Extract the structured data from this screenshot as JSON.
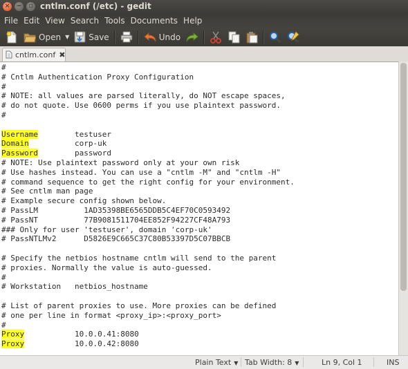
{
  "window": {
    "title": "cntlm.conf (/etc) - gedit",
    "close_glyph": "×",
    "min_glyph": "−",
    "max_glyph": "▫"
  },
  "menu": [
    "File",
    "Edit",
    "View",
    "Search",
    "Tools",
    "Documents",
    "Help"
  ],
  "toolbar": {
    "open_label": "Open",
    "save_label": "Save",
    "undo_label": "Undo",
    "icons": [
      "new-document-icon",
      "open-folder-icon",
      "open-dropdown-icon",
      "save-icon",
      "print-icon",
      "undo-icon",
      "redo-icon",
      "cut-icon",
      "copy-icon",
      "paste-icon",
      "find-icon",
      "find-replace-icon"
    ],
    "colors": {
      "undo_arrow": "#e07a3e",
      "redo_arrow": "#7bb33a",
      "highlight": "#ffff22"
    }
  },
  "tab": {
    "label": "cntlm.conf",
    "close_glyph": "✖"
  },
  "editor": {
    "lines": [
      {
        "text": "#"
      },
      {
        "text": "# Cntlm Authentication Proxy Configuration"
      },
      {
        "text": "#"
      },
      {
        "text": "# NOTE: all values are parsed literally, do NOT escape spaces,"
      },
      {
        "text": "# do not quote. Use 0600 perms if you use plaintext password."
      },
      {
        "text": "#"
      },
      {
        "text": ""
      },
      {
        "key": "Username",
        "rest": "        testuser"
      },
      {
        "key": "Domain",
        "rest": "          corp-uk"
      },
      {
        "key": "Password",
        "rest": "        password"
      },
      {
        "text": "# NOTE: Use plaintext password only at your own risk"
      },
      {
        "text": "# Use hashes instead. You can use a \"cntlm -M\" and \"cntlm -H\""
      },
      {
        "text": "# command sequence to get the right config for your environment."
      },
      {
        "text": "# See cntlm man page"
      },
      {
        "text": "# Example secure config shown below."
      },
      {
        "text": "# PassLM          1AD35398BE6565DDB5C4EF70C0593492"
      },
      {
        "text": "# PassNT          77B9081511704EE852F94227CF48A793"
      },
      {
        "text": "### Only for user 'testuser', domain 'corp-uk'"
      },
      {
        "text": "# PassNTLMv2      D5826E9C665C37C80B53397D5C07BBCB"
      },
      {
        "text": ""
      },
      {
        "text": "# Specify the netbios hostname cntlm will send to the parent"
      },
      {
        "text": "# proxies. Normally the value is auto-guessed."
      },
      {
        "text": "#"
      },
      {
        "text": "# Workstation   netbios_hostname"
      },
      {
        "text": ""
      },
      {
        "text": "# List of parent proxies to use. More proxies can be defined"
      },
      {
        "text": "# one per line in format <proxy_ip>:<proxy_port>"
      },
      {
        "text": "#"
      },
      {
        "key": "Proxy",
        "rest": "           10.0.0.41:8080"
      },
      {
        "key": "Proxy",
        "rest": "           10.0.0.42:8080"
      }
    ]
  },
  "statusbar": {
    "language": "Plain Text",
    "tab_width": "Tab Width: 8",
    "position": "Ln 9, Col 1",
    "mode": "INS",
    "dropdown_glyph": "▼"
  }
}
